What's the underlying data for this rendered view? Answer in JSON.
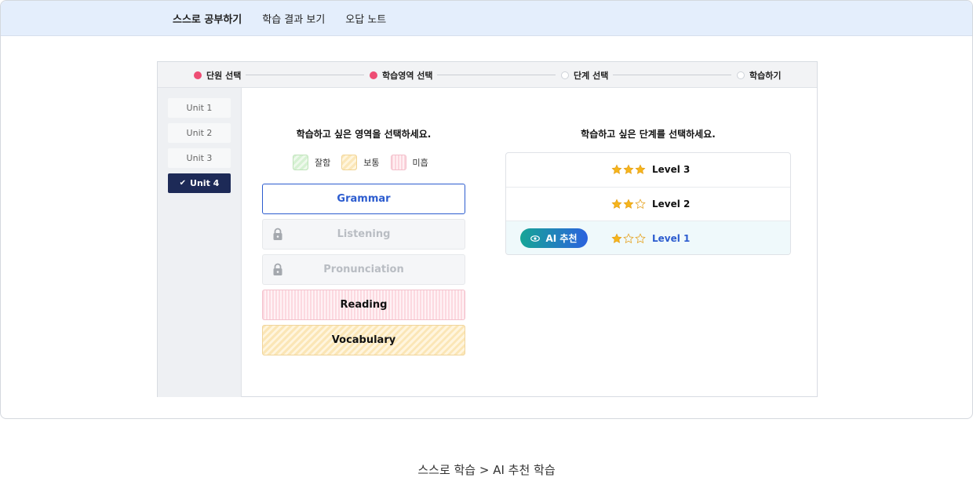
{
  "nav": {
    "items": [
      {
        "label": "스스로 공부하기",
        "active": true
      },
      {
        "label": "학습 결과 보기",
        "active": false
      },
      {
        "label": "오답 노트",
        "active": false
      }
    ]
  },
  "steps": [
    {
      "label": "단원 선택",
      "done": true
    },
    {
      "label": "학습영역 선택",
      "done": true
    },
    {
      "label": "단계 선택",
      "done": false
    },
    {
      "label": "학습하기",
      "done": false
    }
  ],
  "units": [
    {
      "label": "Unit 1",
      "selected": false
    },
    {
      "label": "Unit 2",
      "selected": false
    },
    {
      "label": "Unit 3",
      "selected": false
    },
    {
      "label": "Unit 4",
      "selected": true
    }
  ],
  "area": {
    "heading": "학습하고 싶은 영역을 선택하세요.",
    "legend": [
      {
        "label": "잘함",
        "kind": "good"
      },
      {
        "label": "보통",
        "kind": "normal"
      },
      {
        "label": "미흡",
        "kind": "bad"
      }
    ],
    "items": [
      {
        "label": "Grammar",
        "state": "selected"
      },
      {
        "label": "Listening",
        "state": "locked"
      },
      {
        "label": "Pronunciation",
        "state": "locked"
      },
      {
        "label": "Reading",
        "state": "bad"
      },
      {
        "label": "Vocabulary",
        "state": "normal"
      }
    ]
  },
  "level": {
    "heading": "학습하고 싶은 단계를 선택하세요.",
    "ai_badge": "AI 추천",
    "items": [
      {
        "label": "Level 3",
        "stars": 3,
        "recommended": false
      },
      {
        "label": "Level 2",
        "stars": 2,
        "recommended": false
      },
      {
        "label": "Level 1",
        "stars": 1,
        "recommended": true
      }
    ]
  },
  "colors": {
    "accent_blue": "#2c5ccf",
    "step_done": "#ee4d74",
    "unit_selected": "#1d2a57",
    "star": "#f5b51c"
  },
  "caption": "스스로 학습 > AI 추천 학습"
}
